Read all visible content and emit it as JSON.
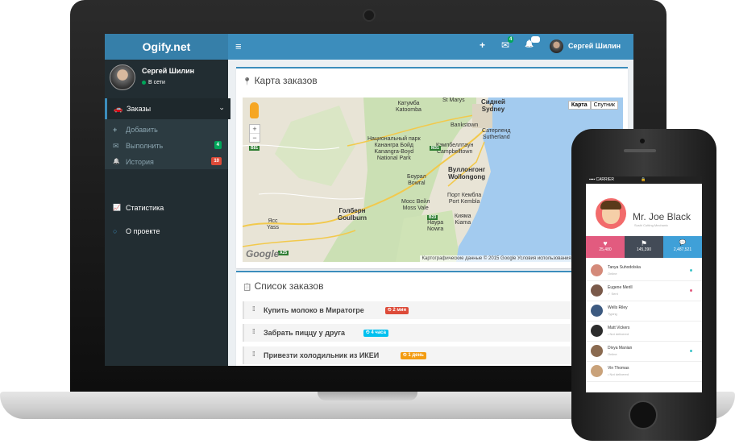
{
  "colors": {
    "primary": "#3c8dbc",
    "sidebar": "#222d32",
    "green": "#00a65a",
    "red": "#dd4b39",
    "aqua": "#00c0ef",
    "orange": "#f39c12",
    "phone_pink": "#e25b7f",
    "phone_dark": "#434b57",
    "phone_blue": "#3fa0d8"
  },
  "app": {
    "logo": "Ogify.net",
    "menu_icon": "≡",
    "user_name": "Сергей Шилин"
  },
  "topbar": {
    "plus_icon": "+",
    "mail_icon": "✉",
    "mail_count": "4",
    "bell_icon": "🔔",
    "bell_count": "30"
  },
  "sidebar": {
    "user_name": "Сергей Шилин",
    "status": "В сети",
    "orders": {
      "icon": "🚗",
      "label": "Заказы",
      "chevron": "‹"
    },
    "sub": [
      {
        "icon": "+",
        "label": "Добавить"
      },
      {
        "icon": "✉",
        "label": "Выполнить",
        "badge": "4"
      },
      {
        "icon": "🔔",
        "label": "История",
        "badge": "10"
      }
    ],
    "stats": {
      "icon": "📈",
      "label": "Статистика"
    },
    "about": {
      "icon": "○",
      "label": "О проекте"
    }
  },
  "map_box": {
    "icon": "📍",
    "title": "Карта заказов",
    "type_map": "Карта",
    "type_sat": "Спутник",
    "zoom_in": "+",
    "zoom_out": "−",
    "footer": "Картографические данные © 2015 Google    Условия использования    Сообщить об ошибке",
    "google": "Google",
    "labels": {
      "katoomba": "Катумба\nKatoomba",
      "sydney": "Сидней\nSydney",
      "saintmarys": "St Marys",
      "bankstown": "Bankstown",
      "sutherland": "Сатерленд\nSutherland",
      "campbelltown": "Кэмпбеллтаун\nCampbelltown",
      "nationalpark": "Национальный парк\nКанангра Бойд\nKanangra-Boyd\nNational Park",
      "wollongong": "Вуллонгонг\nWollongong",
      "bowral": "Боурал\nBowral",
      "portkembla": "Порт Кембла\nPort Kembla",
      "mossvale": "Мосс Вейл\nMoss Vale",
      "goulburn": "Голберн\nGoulburn",
      "kiama": "Кияма\nKiama",
      "nowra": "Наура\nNowra",
      "yass": "Ясс\nYass",
      "sign_b81": "B81",
      "sign_m31": "M31",
      "sign_b23": "B23",
      "sign_a25": "A25"
    }
  },
  "list_box": {
    "icon": "📋",
    "title": "Список заказов",
    "tasks": [
      {
        "text": "Купить молоко в Миратогре",
        "tag": "⏲ 2 мин"
      },
      {
        "text": "Забрать пиццу у друга",
        "tag": "⏲ 4 часа"
      },
      {
        "text": "Привезти холодильник из ИКЕИ",
        "tag": "⏲ 1 день"
      }
    ]
  },
  "phone": {
    "carrier": "▪▪▪▪ CARRIER",
    "lock": "🔒",
    "name": "Mr. Joe Black",
    "subtitle": "Sushi Cutting Mechanic",
    "stats": [
      {
        "icon": "♥",
        "value": "25,480"
      },
      {
        "icon": "⚑",
        "value": "145,390"
      },
      {
        "icon": "💬",
        "value": "2,487,521"
      }
    ],
    "contacts": [
      {
        "name": "Tanya Suhodolska",
        "status": "Online"
      },
      {
        "name": "Eugene Merill",
        "status": "✓ Sent"
      },
      {
        "name": "Wells Riley",
        "status": "Typing"
      },
      {
        "name": "Matt Vickers",
        "status": "• Not delivered"
      },
      {
        "name": "Divya Manian",
        "status": "Online"
      },
      {
        "name": "Vin Thomas",
        "status": "• Not delivered"
      }
    ]
  }
}
